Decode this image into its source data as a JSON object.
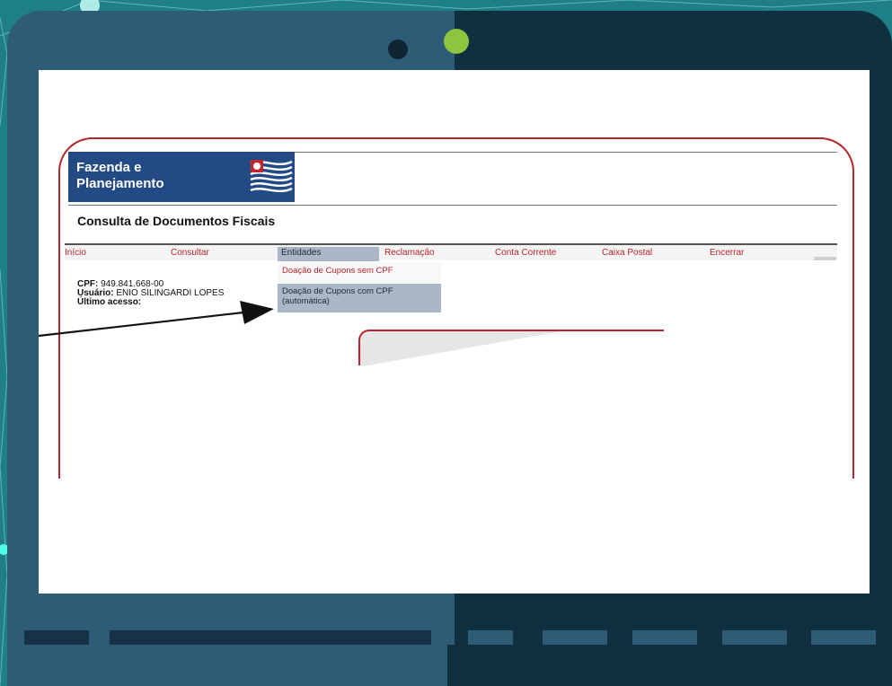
{
  "colors": {
    "background": "#1e7f86",
    "laptop_left": "#2e5b75",
    "laptop_right": "#11303f",
    "camera_green": "#8cc63f",
    "brand_blue": "#244a86",
    "menu_red": "#b8242c",
    "menu_active": "#a9b7c6"
  },
  "site": {
    "logo_line1": "Fazenda e",
    "logo_line2": "Planejamento",
    "page_title": "Consulta de Documentos Fiscais"
  },
  "menu": {
    "items": [
      {
        "label": "Início"
      },
      {
        "label": "Consultar"
      },
      {
        "label": "Entidades",
        "active": true
      },
      {
        "label": "Reclamação"
      },
      {
        "label": "Conta Corrente"
      },
      {
        "label": "Caixa Postal"
      },
      {
        "label": "Encerrar"
      }
    ]
  },
  "dropdown": {
    "item1": "Doação de Cupons sem CPF",
    "item2_line1": "Doação de Cupons com CPF",
    "item2_line2": "(automática)"
  },
  "user_info": {
    "cpf_label": "CPF:",
    "cpf_value": "949.841.668-00",
    "user_label": "Usuário:",
    "user_value": "ENIO SILINGARDI LOPES",
    "last_access_label": "Último acesso:"
  },
  "icons": {
    "flag": "sao-paulo-flag-icon",
    "arrow": "pointer-arrow-icon"
  }
}
